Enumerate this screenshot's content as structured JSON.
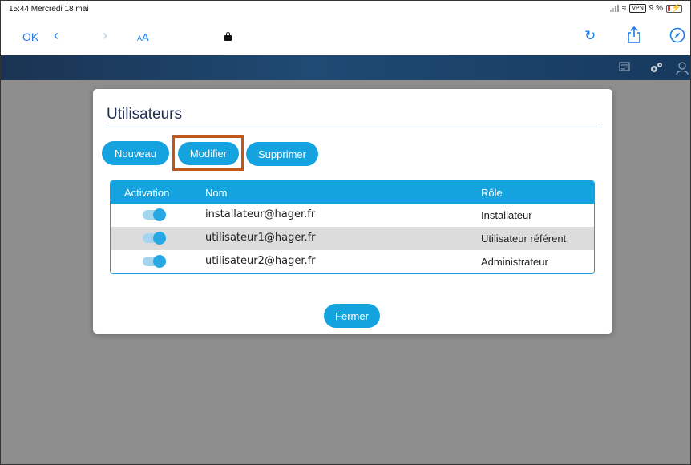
{
  "status_bar": {
    "time_date": "15:44  Mercredi 18 mai",
    "vpn": "VPN",
    "battery_text": "9 %"
  },
  "browser": {
    "ok_label": "OK",
    "back_glyph": "‹",
    "forward_glyph": "›",
    "text_size_label": "AA",
    "icons": [
      "lock-icon",
      "reload-icon",
      "share-icon",
      "compass-icon"
    ]
  },
  "app_nav": {
    "icons": [
      "message-icon",
      "settings-gears-icon",
      "user-icon"
    ]
  },
  "dialog": {
    "title": "Utilisateurs",
    "buttons": {
      "new": "Nouveau",
      "edit": "Modifier",
      "delete": "Supprimer",
      "close": "Fermer"
    },
    "table": {
      "headers": [
        "Activation",
        "Nom",
        "Rôle"
      ],
      "rows": [
        {
          "active": true,
          "name": "installateur@hager.fr",
          "role": "Installateur"
        },
        {
          "active": true,
          "name": "utilisateur1@hager.fr",
          "role": "Utilisateur référent"
        },
        {
          "active": true,
          "name": "utilisateur2@hager.fr",
          "role": "Administrateur"
        }
      ]
    }
  },
  "colors": {
    "accent": "#15a3e0",
    "nav_bar": "#1f4a73",
    "highlight_box": "#c0561a",
    "overlay": "#8e8e8e"
  }
}
